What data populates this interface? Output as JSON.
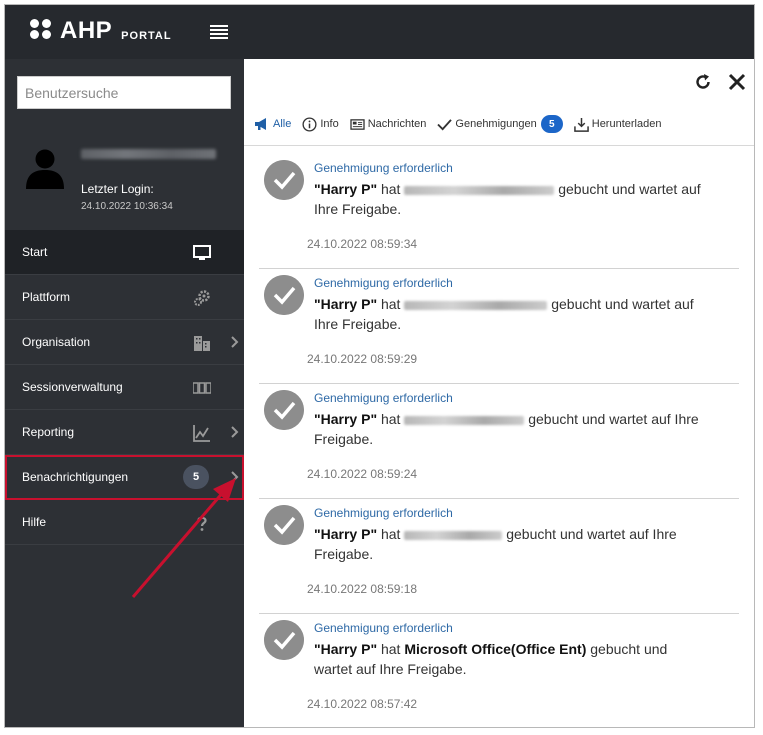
{
  "app": {
    "brand": "AHP",
    "brand_sub": "PORTAL"
  },
  "sidebar": {
    "search_placeholder": "Benutzersuche",
    "user": {
      "login_label": "Letzter Login:",
      "login_time": "24.10.2022 10:36:34"
    },
    "items": [
      {
        "label": "Start",
        "icon": "monitor-icon"
      },
      {
        "label": "Plattform",
        "icon": "gears-icon"
      },
      {
        "label": "Organisation",
        "icon": "buildings-icon"
      },
      {
        "label": "Sessionverwaltung",
        "icon": "sessions-icon"
      },
      {
        "label": "Reporting",
        "icon": "chart-icon"
      },
      {
        "label": "Benachrichtigungen",
        "icon": "bell-icon",
        "badge": "5"
      },
      {
        "label": "Hilfe",
        "icon": "question-icon"
      }
    ]
  },
  "panel": {
    "tabs": [
      {
        "label": "Alle",
        "icon": "megaphone-icon"
      },
      {
        "label": "Info",
        "icon": "info-icon"
      },
      {
        "label": "Nachrichten",
        "icon": "message-icon"
      },
      {
        "label": "Genehmigungen",
        "icon": "check-icon",
        "badge": "5"
      },
      {
        "label": "Herunterladen",
        "icon": "download-icon"
      }
    ],
    "notifications": [
      {
        "title": "Genehmigung erforderlich",
        "user": "\"Harry P\"",
        "verb": "hat",
        "item": "",
        "suffix": "gebucht und wartet auf Ihre Freigabe.",
        "time": "24.10.2022 08:59:34"
      },
      {
        "title": "Genehmigung erforderlich",
        "user": "\"Harry P\"",
        "verb": "hat",
        "item": "",
        "suffix": "gebucht und wartet auf Ihre Freigabe.",
        "time": "24.10.2022 08:59:29"
      },
      {
        "title": "Genehmigung erforderlich",
        "user": "\"Harry P\"",
        "verb": "hat",
        "item": "",
        "suffix": "gebucht und wartet auf Ihre Freigabe.",
        "time": "24.10.2022 08:59:24"
      },
      {
        "title": "Genehmigung erforderlich",
        "user": "\"Harry P\"",
        "verb": "hat",
        "item": "",
        "suffix": "gebucht und wartet auf Ihre Freigabe.",
        "time": "24.10.2022 08:59:18"
      },
      {
        "title": "Genehmigung erforderlich",
        "user": "\"Harry P\"",
        "verb": "hat",
        "item": "Microsoft Office(Office Ent)",
        "suffix": "gebucht und wartet auf Ihre Freigabe.",
        "time": "24.10.2022 08:57:42"
      }
    ]
  },
  "colors": {
    "accent": "#1c66c8",
    "highlight": "#c8102e",
    "approve": "#3aa64a",
    "reject": "#d9363e"
  }
}
